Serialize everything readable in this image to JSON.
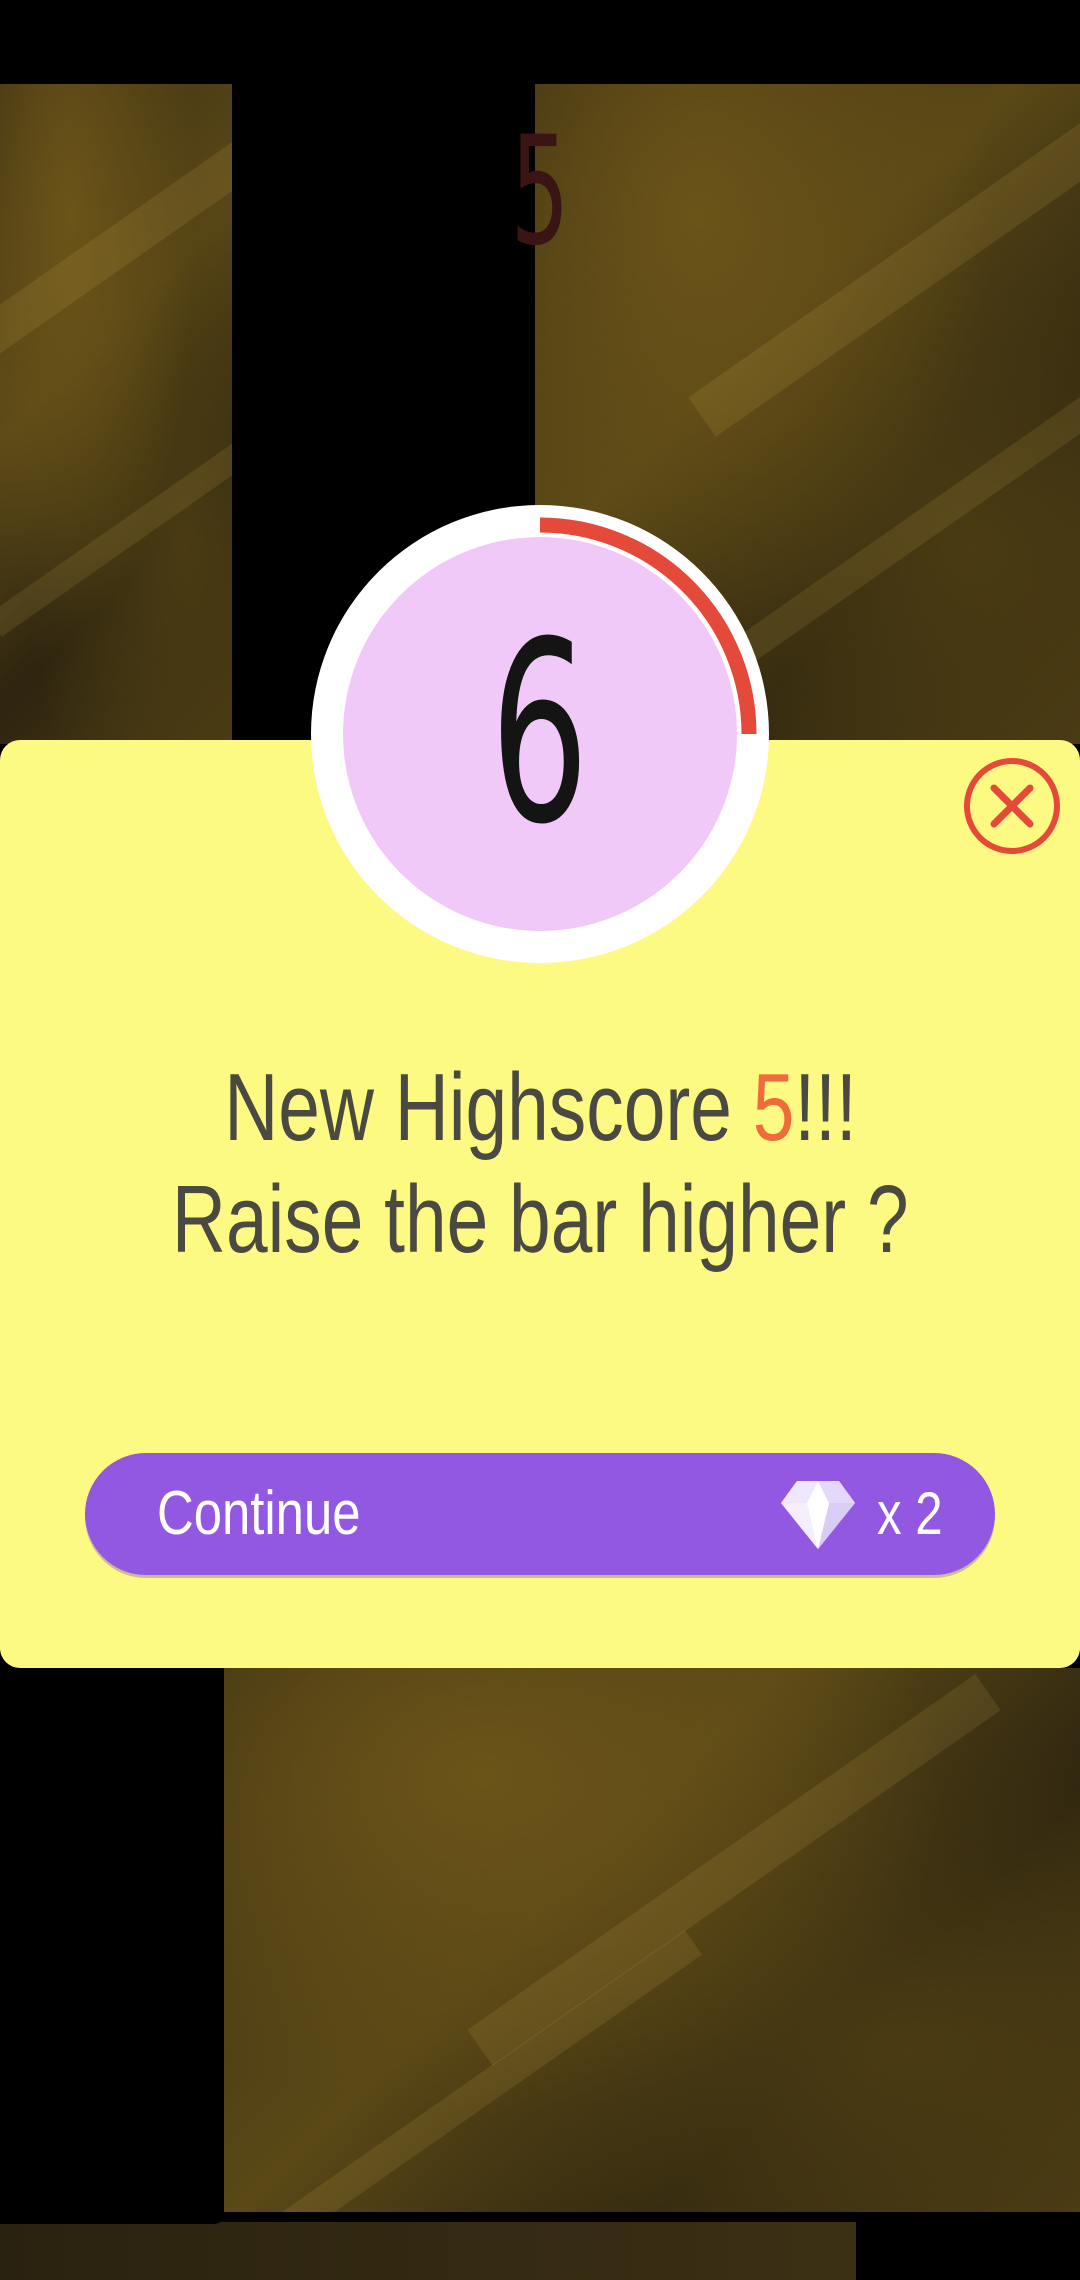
{
  "game": {
    "current_score": "5"
  },
  "timer": {
    "countdown": "6",
    "progress": 0.25,
    "ring_color": "#e5493a"
  },
  "dialog": {
    "line1_prefix": "New Highscore ",
    "line1_score": "5",
    "line1_suffix": "!!!",
    "line2": "Raise the bar higher ?",
    "close_icon": "close-circle-icon",
    "background_color": "#fdfa84"
  },
  "continue_button": {
    "label": "Continue",
    "cost_icon": "diamond-icon",
    "cost": "x 2",
    "color": "#9358e2"
  }
}
